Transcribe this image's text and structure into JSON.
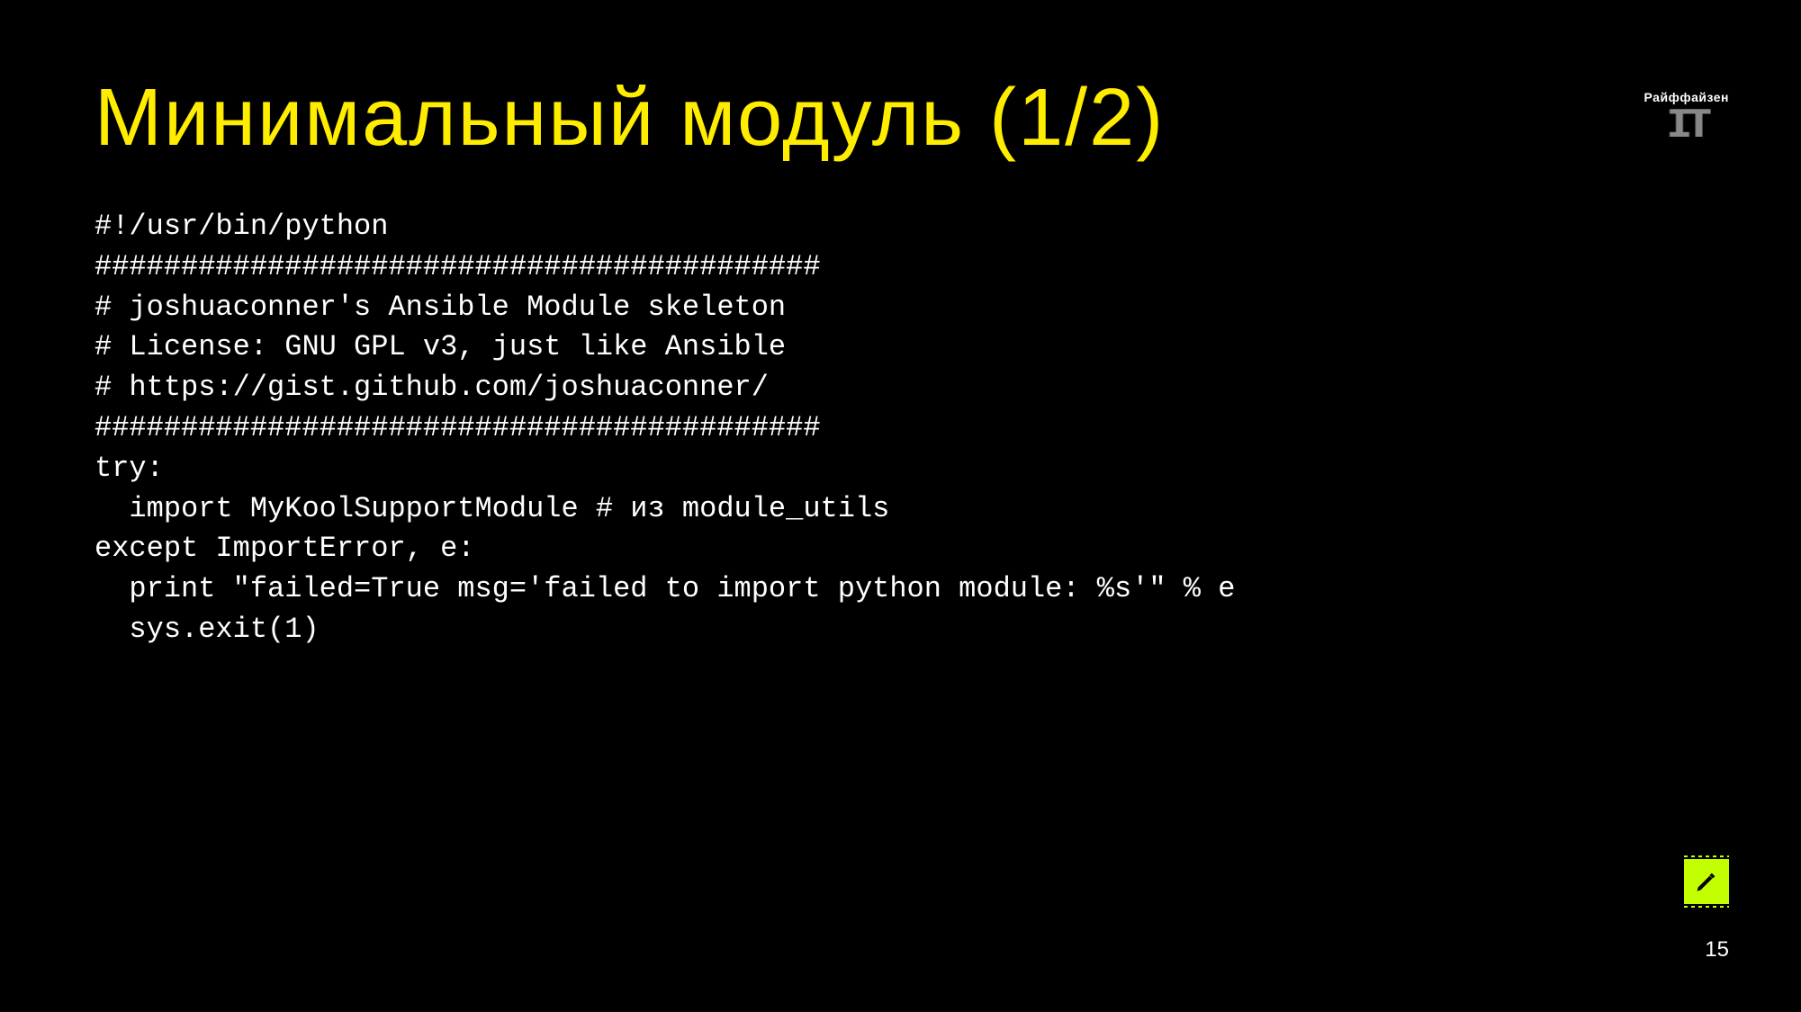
{
  "title": "Минимальный модуль (1/2)",
  "code": "#!/usr/bin/python\n##########################################\n# joshuaconner's Ansible Module skeleton\n# License: GNU GPL v3, just like Ansible\n# https://gist.github.com/joshuaconner/\n##########################################\ntry:\n  import MyKoolSupportModule # из module_utils\nexcept ImportError, e:\n  print \"failed=True msg='failed to import python module: %s'\" % e\n  sys.exit(1)",
  "page_number": "15",
  "brand": {
    "name": "Райффайзен",
    "sub": "IT"
  }
}
